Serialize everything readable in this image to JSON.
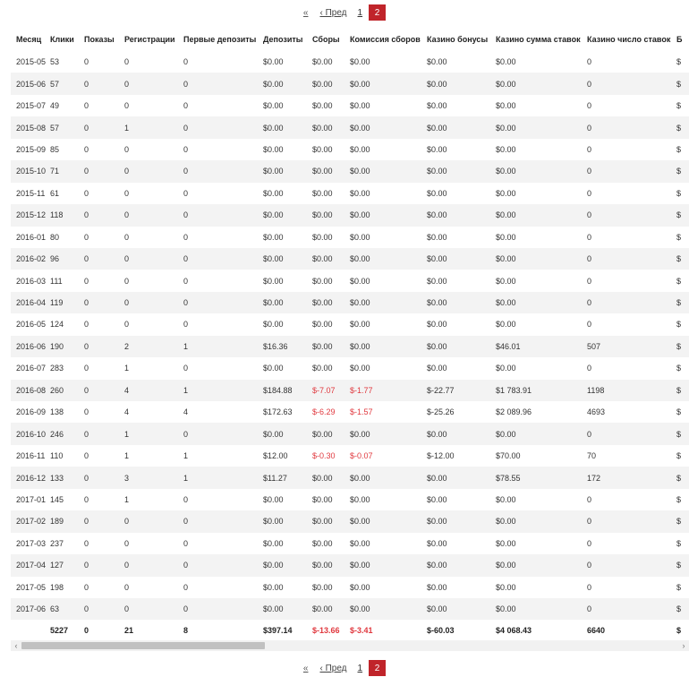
{
  "pagination": {
    "first": "«",
    "prev": "‹ Пред",
    "pages": [
      "1",
      "2"
    ],
    "current": "2"
  },
  "table": {
    "headers": [
      "Месяц",
      "Клики",
      "Показы",
      "Регистрации",
      "Первые депозиты",
      "Депозиты",
      "Сборы",
      "Комиссия сборов",
      "Казино бонусы",
      "Казино сумма ставок",
      "Казино число ставок",
      "Б"
    ],
    "rows": [
      [
        "2015-05",
        "53",
        "0",
        "0",
        "0",
        "$0.00",
        "$0.00",
        "$0.00",
        "$0.00",
        "$0.00",
        "0",
        "$"
      ],
      [
        "2015-06",
        "57",
        "0",
        "0",
        "0",
        "$0.00",
        "$0.00",
        "$0.00",
        "$0.00",
        "$0.00",
        "0",
        "$"
      ],
      [
        "2015-07",
        "49",
        "0",
        "0",
        "0",
        "$0.00",
        "$0.00",
        "$0.00",
        "$0.00",
        "$0.00",
        "0",
        "$"
      ],
      [
        "2015-08",
        "57",
        "0",
        "1",
        "0",
        "$0.00",
        "$0.00",
        "$0.00",
        "$0.00",
        "$0.00",
        "0",
        "$"
      ],
      [
        "2015-09",
        "85",
        "0",
        "0",
        "0",
        "$0.00",
        "$0.00",
        "$0.00",
        "$0.00",
        "$0.00",
        "0",
        "$"
      ],
      [
        "2015-10",
        "71",
        "0",
        "0",
        "0",
        "$0.00",
        "$0.00",
        "$0.00",
        "$0.00",
        "$0.00",
        "0",
        "$"
      ],
      [
        "2015-11",
        "61",
        "0",
        "0",
        "0",
        "$0.00",
        "$0.00",
        "$0.00",
        "$0.00",
        "$0.00",
        "0",
        "$"
      ],
      [
        "2015-12",
        "118",
        "0",
        "0",
        "0",
        "$0.00",
        "$0.00",
        "$0.00",
        "$0.00",
        "$0.00",
        "0",
        "$"
      ],
      [
        "2016-01",
        "80",
        "0",
        "0",
        "0",
        "$0.00",
        "$0.00",
        "$0.00",
        "$0.00",
        "$0.00",
        "0",
        "$"
      ],
      [
        "2016-02",
        "96",
        "0",
        "0",
        "0",
        "$0.00",
        "$0.00",
        "$0.00",
        "$0.00",
        "$0.00",
        "0",
        "$"
      ],
      [
        "2016-03",
        "111",
        "0",
        "0",
        "0",
        "$0.00",
        "$0.00",
        "$0.00",
        "$0.00",
        "$0.00",
        "0",
        "$"
      ],
      [
        "2016-04",
        "119",
        "0",
        "0",
        "0",
        "$0.00",
        "$0.00",
        "$0.00",
        "$0.00",
        "$0.00",
        "0",
        "$"
      ],
      [
        "2016-05",
        "124",
        "0",
        "0",
        "0",
        "$0.00",
        "$0.00",
        "$0.00",
        "$0.00",
        "$0.00",
        "0",
        "$"
      ],
      [
        "2016-06",
        "190",
        "0",
        "2",
        "1",
        "$16.36",
        "$0.00",
        "$0.00",
        "$0.00",
        "$46.01",
        "507",
        "$"
      ],
      [
        "2016-07",
        "283",
        "0",
        "1",
        "0",
        "$0.00",
        "$0.00",
        "$0.00",
        "$0.00",
        "$0.00",
        "0",
        "$"
      ],
      [
        "2016-08",
        "260",
        "0",
        "4",
        "1",
        "$184.88",
        "$-7.07",
        "$-1.77",
        "$-22.77",
        "$1 783.91",
        "1198",
        "$"
      ],
      [
        "2016-09",
        "138",
        "0",
        "4",
        "4",
        "$172.63",
        "$-6.29",
        "$-1.57",
        "$-25.26",
        "$2 089.96",
        "4693",
        "$"
      ],
      [
        "2016-10",
        "246",
        "0",
        "1",
        "0",
        "$0.00",
        "$0.00",
        "$0.00",
        "$0.00",
        "$0.00",
        "0",
        "$"
      ],
      [
        "2016-11",
        "110",
        "0",
        "1",
        "1",
        "$12.00",
        "$-0.30",
        "$-0.07",
        "$-12.00",
        "$70.00",
        "70",
        "$"
      ],
      [
        "2016-12",
        "133",
        "0",
        "3",
        "1",
        "$11.27",
        "$0.00",
        "$0.00",
        "$0.00",
        "$78.55",
        "172",
        "$"
      ],
      [
        "2017-01",
        "145",
        "0",
        "1",
        "0",
        "$0.00",
        "$0.00",
        "$0.00",
        "$0.00",
        "$0.00",
        "0",
        "$"
      ],
      [
        "2017-02",
        "189",
        "0",
        "0",
        "0",
        "$0.00",
        "$0.00",
        "$0.00",
        "$0.00",
        "$0.00",
        "0",
        "$"
      ],
      [
        "2017-03",
        "237",
        "0",
        "0",
        "0",
        "$0.00",
        "$0.00",
        "$0.00",
        "$0.00",
        "$0.00",
        "0",
        "$"
      ],
      [
        "2017-04",
        "127",
        "0",
        "0",
        "0",
        "$0.00",
        "$0.00",
        "$0.00",
        "$0.00",
        "$0.00",
        "0",
        "$"
      ],
      [
        "2017-05",
        "198",
        "0",
        "0",
        "0",
        "$0.00",
        "$0.00",
        "$0.00",
        "$0.00",
        "$0.00",
        "0",
        "$"
      ],
      [
        "2017-06",
        "63",
        "0",
        "0",
        "0",
        "$0.00",
        "$0.00",
        "$0.00",
        "$0.00",
        "$0.00",
        "0",
        "$"
      ]
    ],
    "totals": [
      "",
      "5227",
      "0",
      "21",
      "8",
      "$397.14",
      "$-13.66",
      "$-3.41",
      "$-60.03",
      "$4 068.43",
      "6640",
      "$"
    ]
  },
  "scrollbar": {
    "left_arrow": "‹",
    "right_arrow": "›"
  },
  "colors": {
    "accent": "#c0242a",
    "negative": "#e0383e",
    "stripe": "#f3f3f3"
  }
}
